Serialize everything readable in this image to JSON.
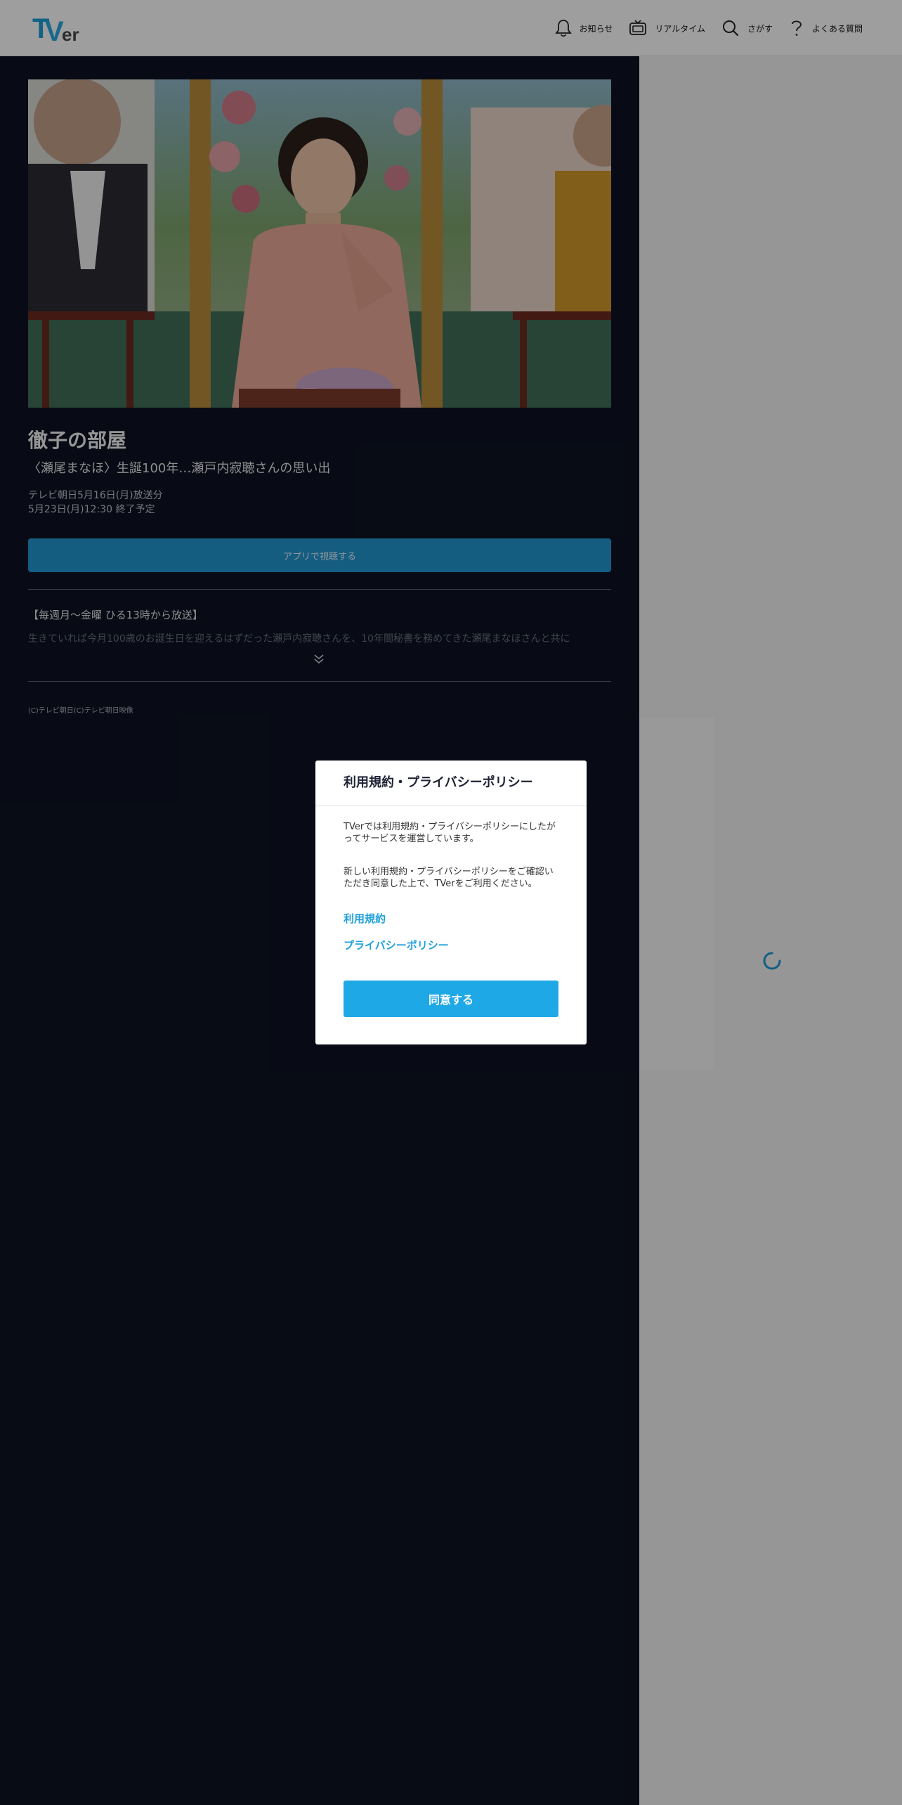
{
  "header": {
    "logo_text_t": "T",
    "logo_text_v": "V",
    "logo_text_er": "er",
    "nav": [
      {
        "label": "お知らせ",
        "icon": "bell-icon"
      },
      {
        "label": "リアルタイム",
        "icon": "tv-icon"
      },
      {
        "label": "さがす",
        "icon": "search-icon"
      },
      {
        "label": "よくある質問",
        "icon": "question-icon"
      }
    ]
  },
  "episode": {
    "title": "徹子の部屋",
    "subtitle": "〈瀬尾まなほ〉生誕100年…瀬戸内寂聴さんの思い出",
    "broadcast": "テレビ朝日5月16日(月)放送分",
    "end_date": "5月23日(月)12:30 終了予定",
    "watch_label": "アプリで視聴する",
    "description_heading": "【毎週月～金曜 ひる13時から放送】",
    "description_faded": "生きていれば今月100歳のお誕生日を迎えるはずだった瀬戸内寂聴さんを、10年間秘書を務めてきた瀬尾まなほさんと共に",
    "copyright": "(C)テレビ朝日(C)テレビ朝日映像"
  },
  "modal": {
    "title": "利用規約・プライバシーポリシー",
    "paragraph1": "TVerでは利用規約・プライバシーポリシーにしたがってサービスを運営しています。",
    "paragraph2": "新しい利用規約・プライバシーポリシーをご確認いただき同意した上で、TVerをご利用ください。",
    "terms_link": "利用規約",
    "privacy_link": "プライバシーポリシー",
    "agree_label": "同意する"
  },
  "colors": {
    "accent": "#1fa8e6",
    "panel": "#0d1322"
  }
}
